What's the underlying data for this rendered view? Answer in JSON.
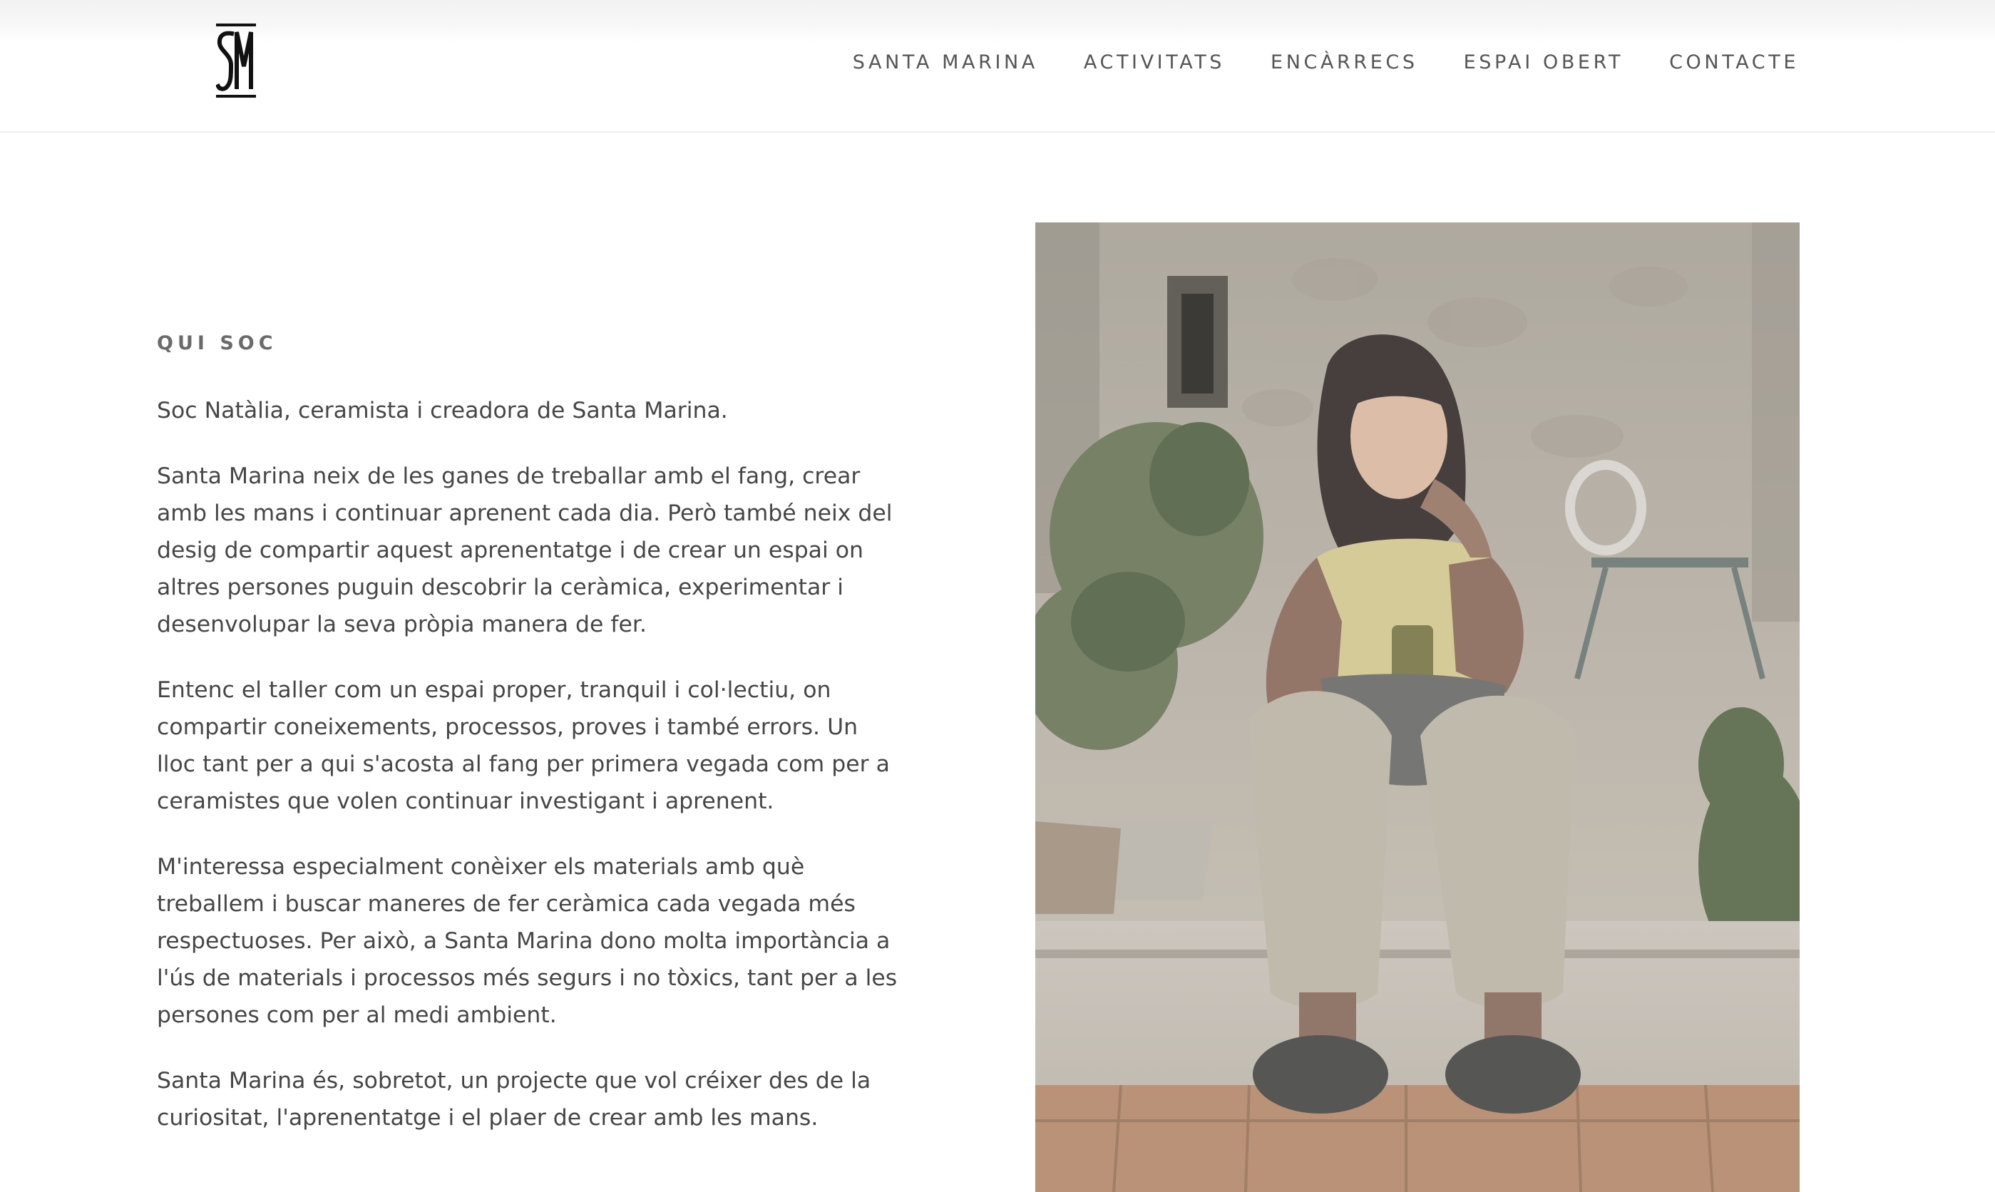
{
  "header": {
    "logo_text": "SM",
    "nav": [
      {
        "label": "SANTA MARINA"
      },
      {
        "label": "ACTIVITATS"
      },
      {
        "label": "ENCÀRRECS"
      },
      {
        "label": "ESPAI OBERT"
      },
      {
        "label": "CONTACTE"
      }
    ]
  },
  "about": {
    "eyebrow": "QUI SOC",
    "paragraphs": [
      "Soc Natàlia, ceramista i creadora de Santa Marina.",
      "Santa Marina neix de les ganes de treballar amb el fang, crear amb les mans i continuar aprenent cada dia. Però també neix del desig de compartir aquest aprenentatge i de crear un espai on altres persones puguin descobrir la ceràmica, experimentar i desenvolupar la seva pròpia manera de fer.",
      "Entenc el taller com un espai proper, tranquil i col·lectiu, on compartir coneixements, processos, proves i també errors. Un lloc tant per a qui s'acosta al fang per primera vegada com per a ceramistes que volen continuar investigant i aprenent.",
      "M'interessa especialment conèixer els materials amb què treballem i buscar maneres de fer ceràmica cada vegada més respectuoses. Per això, a Santa Marina dono molta importància a l'ús de materials i processos més segurs i no tòxics, tant per a les persones com per al medi ambient.",
      "Santa Marina és, sobretot, un projecte que vol créixer des de la curiositat, l'aprenentatge i el plaer de crear amb les mans."
    ]
  },
  "colors": {
    "text": "#464646",
    "nav_text": "#555555",
    "background": "#ffffff"
  }
}
